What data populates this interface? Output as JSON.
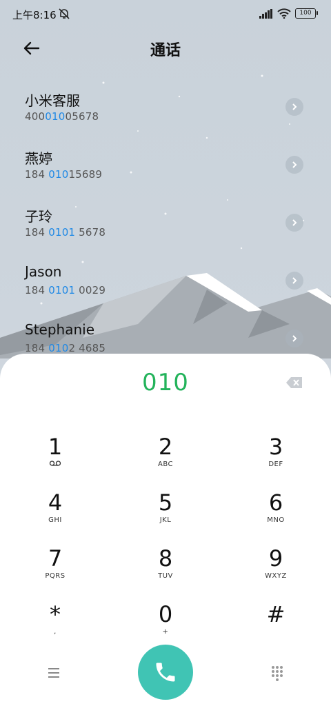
{
  "status_bar": {
    "time": "上午8:16",
    "battery": "100"
  },
  "header": {
    "title": "通话"
  },
  "contacts": [
    {
      "name": "小米客服",
      "number_parts": [
        "400",
        "010",
        "05678"
      ]
    },
    {
      "name": "燕婷",
      "number_parts": [
        "184 ",
        "010",
        "15689"
      ]
    },
    {
      "name": "子玲",
      "number_parts": [
        "184 ",
        "0101",
        " 5678"
      ]
    },
    {
      "name": "Jason",
      "number_parts": [
        "184 ",
        "0101",
        " 0029"
      ]
    },
    {
      "name": "Stephanie",
      "number_parts": [
        "184 ",
        "010",
        "2 4685"
      ]
    }
  ],
  "dialer": {
    "input": "010",
    "keys": [
      {
        "digit": "1",
        "letters": ""
      },
      {
        "digit": "2",
        "letters": "ABC"
      },
      {
        "digit": "3",
        "letters": "DEF"
      },
      {
        "digit": "4",
        "letters": "GHI"
      },
      {
        "digit": "5",
        "letters": "JKL"
      },
      {
        "digit": "6",
        "letters": "MNO"
      },
      {
        "digit": "7",
        "letters": "PQRS"
      },
      {
        "digit": "8",
        "letters": "TUV"
      },
      {
        "digit": "9",
        "letters": "WXYZ"
      },
      {
        "digit": "*",
        "letters": ","
      },
      {
        "digit": "0",
        "letters": "+"
      },
      {
        "digit": "#",
        "letters": ""
      }
    ]
  },
  "colors": {
    "accent_green": "#23b35b",
    "highlight_blue": "#1e88e5",
    "call_button": "#40c4b4"
  },
  "icons": {
    "back": "arrow-left-icon",
    "mute": "bell-off-icon",
    "signal": "signal-icon",
    "wifi": "wifi-icon",
    "backspace": "backspace-icon",
    "voicemail": "voicemail-icon",
    "menu": "menu-icon",
    "call": "phone-icon",
    "dialpad": "dialpad-icon"
  }
}
